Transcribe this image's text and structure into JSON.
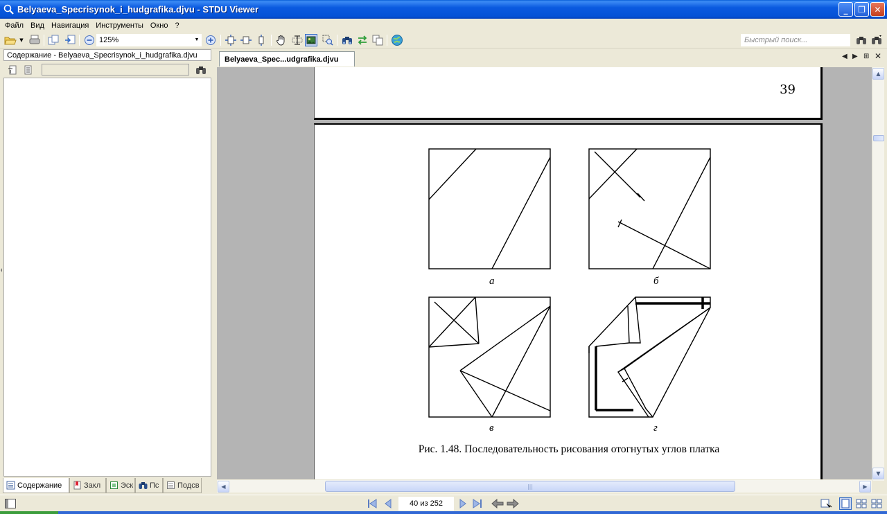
{
  "window": {
    "title": "Belyaeva_Specrisynok_i_hudgrafika.djvu - STDU Viewer",
    "minimize": "_",
    "maximize": "❐",
    "close": "✕"
  },
  "menu": [
    "Файл",
    "Вид",
    "Навигация",
    "Инструменты",
    "Окно",
    "?"
  ],
  "toolbar": {
    "zoom_value": "125%",
    "quick_search_placeholder": "Быстрый поиск..."
  },
  "left_panel": {
    "header": "Содержание - Belyaeva_Specrisynok_i_hudgrafika.djvu",
    "search_value": "",
    "tabs": [
      {
        "label": "Содержание",
        "icon": "contents-icon"
      },
      {
        "label": "Закл",
        "icon": "bookmark-icon"
      },
      {
        "label": "Эск",
        "icon": "thumbnail-icon"
      },
      {
        "label": "Пс",
        "icon": "search-icon"
      },
      {
        "label": "Подсв",
        "icon": "highlight-icon"
      }
    ]
  },
  "document": {
    "tab_label": "Belyaeva_Spec...udgrafika.djvu",
    "page_number_printed": "39",
    "figure_labels": {
      "a": "а",
      "b": "б",
      "c": "в",
      "d": "г"
    },
    "caption": "Рис. 1.48. Последовательность рисования отогнутых углов платка"
  },
  "statusbar": {
    "page_indicator": "40 из 252"
  },
  "colors": {
    "titlebar": "#0552d6",
    "chrome": "#ece9d8",
    "viewport_bg": "#b4b4b4"
  }
}
